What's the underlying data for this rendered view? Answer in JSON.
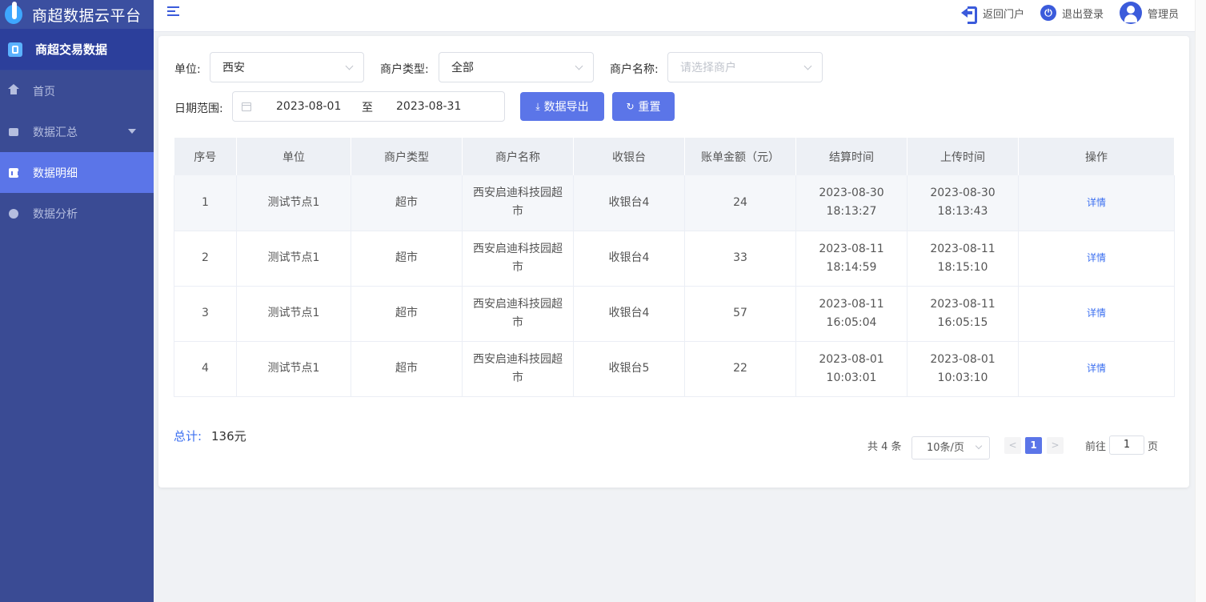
{
  "app": {
    "brand_title": "商超数据云平台",
    "system_title": "商超交易数据"
  },
  "sidebar": {
    "items": [
      {
        "label": "首页",
        "icon": "home-icon"
      },
      {
        "label": "数据汇总",
        "icon": "summary-icon",
        "expandable": true
      },
      {
        "label": "数据明细",
        "icon": "detail-icon",
        "active": true
      },
      {
        "label": "数据分析",
        "icon": "pie-chart-icon"
      }
    ]
  },
  "header": {
    "back_portal": "返回门户",
    "logout": "退出登录",
    "user": "管理员"
  },
  "filters": {
    "unit_label": "单位:",
    "unit_value": "西安",
    "merchant_type_label": "商户类型:",
    "merchant_type_value": "全部",
    "merchant_name_label": "商户名称:",
    "merchant_name_placeholder": "请选择商户",
    "date_range_label": "日期范围:",
    "date_start": "2023-08-01",
    "date_separator": "至",
    "date_end": "2023-08-31",
    "export_button": "数据导出",
    "reset_button": "重置"
  },
  "table": {
    "columns": [
      "序号",
      "单位",
      "商户类型",
      "商户名称",
      "收银台",
      "账单金额（元）",
      "结算时间",
      "上传时间",
      "操作"
    ],
    "rows": [
      {
        "index": "1",
        "unit": "测试节点1",
        "type": "超市",
        "merchant": "西安启迪科技园超市",
        "cashier": "收银台4",
        "amount": "24",
        "settle_time": "2023-08-30 18:13:27",
        "upload_time": "2023-08-30 18:13:43",
        "action": "详情"
      },
      {
        "index": "2",
        "unit": "测试节点1",
        "type": "超市",
        "merchant": "西安启迪科技园超市",
        "cashier": "收银台4",
        "amount": "33",
        "settle_time": "2023-08-11 18:14:59",
        "upload_time": "2023-08-11 18:15:10",
        "action": "详情"
      },
      {
        "index": "3",
        "unit": "测试节点1",
        "type": "超市",
        "merchant": "西安启迪科技园超市",
        "cashier": "收银台4",
        "amount": "57",
        "settle_time": "2023-08-11 16:05:04",
        "upload_time": "2023-08-11 16:05:15",
        "action": "详情"
      },
      {
        "index": "4",
        "unit": "测试节点1",
        "type": "超市",
        "merchant": "西安启迪科技园超市",
        "cashier": "收银台5",
        "amount": "22",
        "settle_time": "2023-08-01 10:03:01",
        "upload_time": "2023-08-01 10:03:10",
        "action": "详情"
      }
    ]
  },
  "summary": {
    "total_label": "总计:",
    "total_value": "136元"
  },
  "pagination": {
    "total_text": "共 4 条",
    "page_size": "10条/页",
    "prev": "<",
    "current_page": "1",
    "next": ">",
    "goto_label": "前往",
    "goto_value": "1",
    "goto_suffix": "页"
  },
  "colors": {
    "sidebar_bg": "#3a4b94",
    "accent": "#5b75e8",
    "link": "#3b6ff0"
  }
}
